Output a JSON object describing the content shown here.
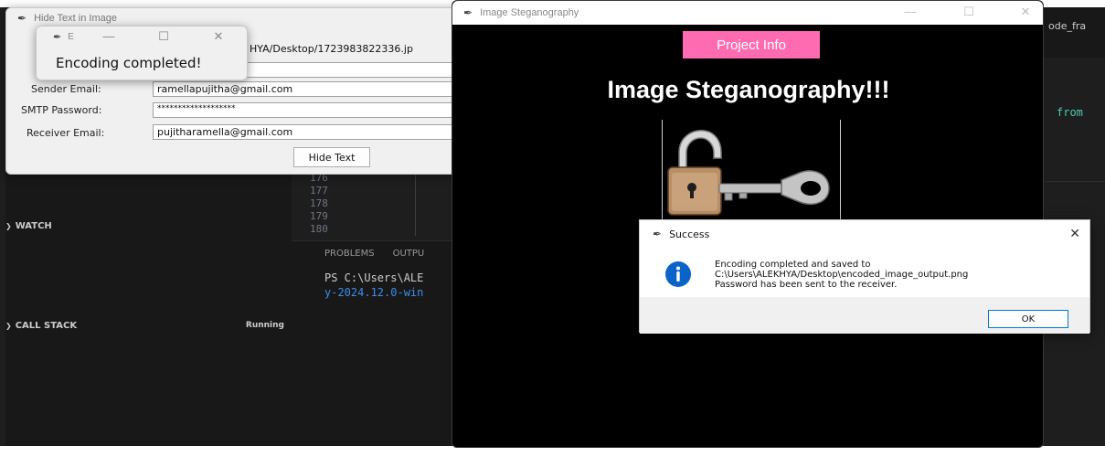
{
  "vscode": {
    "watch_label": "WATCH",
    "callstack_label": "CALL STACK",
    "callstack_status": "Running",
    "line_numbers": [
      "176",
      "177",
      "178",
      "179",
      "180"
    ],
    "panel_tabs": [
      "PROBLEMS",
      "OUTPU"
    ],
    "terminal_line_1": "PS C:\\Users\\ALE",
    "terminal_line_2": "y-2024.12.0-win",
    "right_tab_label": "ode_fra",
    "right_code": "from"
  },
  "hide_window": {
    "title": "Hide Text in Image",
    "path_fragment": "HYA/Desktop/1723983822336.jp",
    "sender_email_label": "Sender Email:",
    "sender_email_value": "ramellapujitha@gmail.com",
    "smtp_password_label": "SMTP Password:",
    "smtp_password_value": "*******************",
    "receiver_email_label": "Receiver Email:",
    "receiver_email_value": "pujitharamella@gmail.com",
    "hide_button": "Hide Text"
  },
  "encoding_popup": {
    "title": "E",
    "message": "Encoding completed!"
  },
  "steg_window": {
    "title": "Image Steganography",
    "project_info_button": "Project Info",
    "heading": "Image Steganography!!!"
  },
  "success_dialog": {
    "title": "Success",
    "line_1": "Encoding completed and saved to",
    "line_2": "C:\\Users\\ALEKHYA/Desktop\\encoded_image_output.png",
    "line_3": "Password has been sent to the receiver.",
    "ok_button": "OK"
  },
  "colors": {
    "accent_pink": "#ff6bb1",
    "info_blue": "#0a64c8",
    "ok_border": "#0078d4"
  }
}
